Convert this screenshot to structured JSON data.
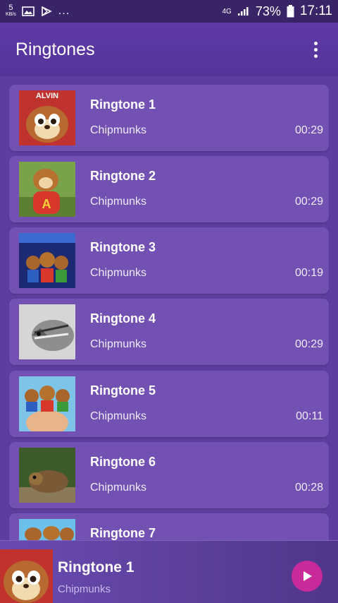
{
  "status_bar": {
    "kbs_value": "5",
    "kbs_unit": "KB/s",
    "icons": [
      "image-icon",
      "play-store-icon"
    ],
    "overflow": "...",
    "network": "4G",
    "battery_percent": "73%",
    "time": "17:11"
  },
  "app_bar": {
    "title": "Ringtones",
    "menu_icon": "more-vert-icon"
  },
  "ringtones": [
    {
      "title": "Ringtone 1",
      "artist": "Chipmunks",
      "duration": "00:29",
      "thumb_caption": "ALVIN"
    },
    {
      "title": "Ringtone 2",
      "artist": "Chipmunks",
      "duration": "00:29"
    },
    {
      "title": "Ringtone 3",
      "artist": "Chipmunks",
      "duration": "00:19"
    },
    {
      "title": "Ringtone 4",
      "artist": "Chipmunks",
      "duration": "00:29"
    },
    {
      "title": "Ringtone 5",
      "artist": "Chipmunks",
      "duration": "00:11"
    },
    {
      "title": "Ringtone 6",
      "artist": "Chipmunks",
      "duration": "00:28"
    },
    {
      "title": "Ringtone 7"
    }
  ],
  "player": {
    "title": "Ringtone 1",
    "artist": "Chipmunks",
    "play_icon": "play-icon"
  },
  "colors": {
    "background": "#5b3aa0",
    "card": "#7251b3",
    "status_bar": "#3a2468",
    "play_button": "#c92a9a"
  }
}
